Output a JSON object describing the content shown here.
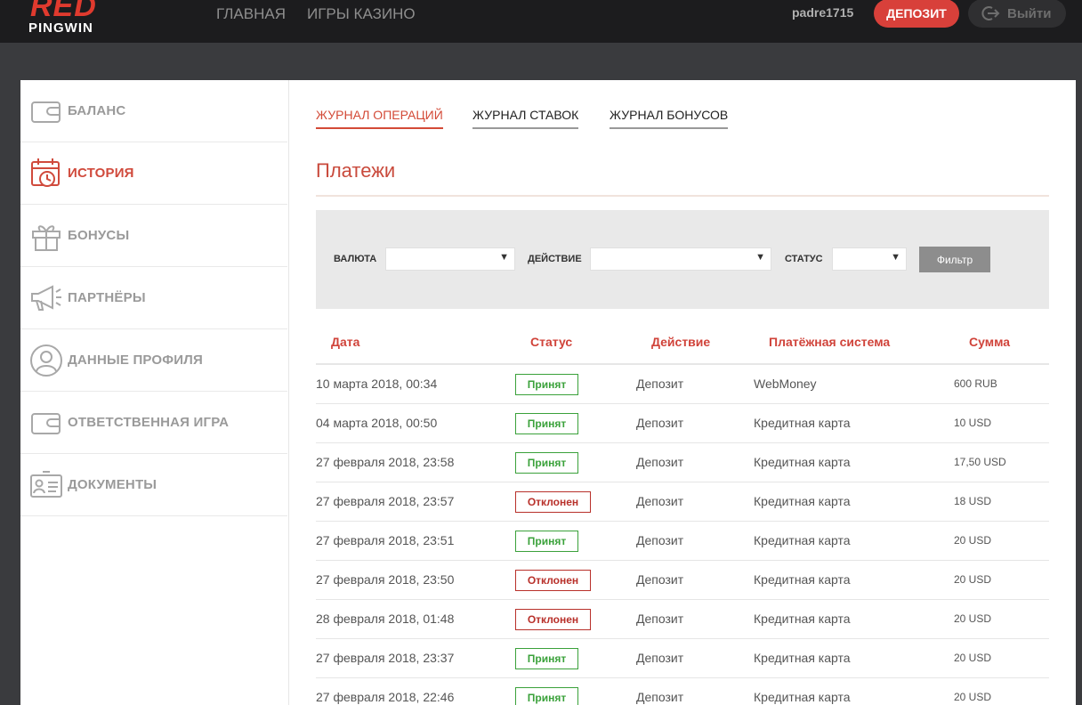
{
  "header": {
    "logo_top": "RED",
    "logo_bottom": "PINGWIN",
    "nav": [
      {
        "label": "ГЛАВНАЯ"
      },
      {
        "label": "ИГРЫ КАЗИНО"
      }
    ],
    "username": "padre1715",
    "deposit_label": "ДЕПОЗИТ",
    "logout_label": "Выйти"
  },
  "sidebar": {
    "items": [
      {
        "label": "БАЛАНС",
        "icon": "wallet-icon"
      },
      {
        "label": "ИСТОРИЯ",
        "icon": "calendar-clock-icon",
        "active": true
      },
      {
        "label": "БОНУСЫ",
        "icon": "gift-icon"
      },
      {
        "label": "ПАРТНЁРЫ",
        "icon": "megaphone-icon"
      },
      {
        "label": "ДАННЫЕ ПРОФИЛЯ",
        "icon": "user-profile-icon"
      },
      {
        "label": "ОТВЕТСТВЕННАЯ ИГРА",
        "icon": "wallet-icon"
      },
      {
        "label": "ДОКУМЕНТЫ",
        "icon": "id-card-icon"
      }
    ]
  },
  "tabs": [
    {
      "label": "ЖУРНАЛ ОПЕРАЦИЙ",
      "active": true
    },
    {
      "label": "ЖУРНАЛ СТАВОК"
    },
    {
      "label": "ЖУРНАЛ БОНУСОВ"
    }
  ],
  "section_title": "Платежи",
  "filter": {
    "currency_label": "ВАЛЮТА",
    "action_label": "ДЕЙСТВИЕ",
    "status_label": "СТАТУС",
    "currency_value": "",
    "action_value": "",
    "status_value": "",
    "button_label": "Фильтр"
  },
  "table": {
    "columns": [
      "Дата",
      "Статус",
      "Действие",
      "Платёжная система",
      "Сумма"
    ],
    "rows": [
      {
        "date": "10 марта 2018, 00:34",
        "status": "Принят",
        "status_type": "ok",
        "action": "Депозит",
        "system": "WebMoney",
        "amount": "600 RUB"
      },
      {
        "date": "04 марта 2018, 00:50",
        "status": "Принят",
        "status_type": "ok",
        "action": "Депозит",
        "system": "Кредитная карта",
        "amount": "10 USD"
      },
      {
        "date": "27 февраля 2018, 23:58",
        "status": "Принят",
        "status_type": "ok",
        "action": "Депозит",
        "system": "Кредитная карта",
        "amount": "17,50 USD"
      },
      {
        "date": "27 февраля 2018, 23:57",
        "status": "Отклонен",
        "status_type": "bad",
        "action": "Депозит",
        "system": "Кредитная карта",
        "amount": "18 USD"
      },
      {
        "date": "27 февраля 2018, 23:51",
        "status": "Принят",
        "status_type": "ok",
        "action": "Депозит",
        "system": "Кредитная карта",
        "amount": "20 USD"
      },
      {
        "date": "27 февраля 2018, 23:50",
        "status": "Отклонен",
        "status_type": "bad",
        "action": "Депозит",
        "system": "Кредитная карта",
        "amount": "20 USD"
      },
      {
        "date": "28 февраля 2018, 01:48",
        "status": "Отклонен",
        "status_type": "bad",
        "action": "Депозит",
        "system": "Кредитная карта",
        "amount": "20 USD"
      },
      {
        "date": "27 февраля 2018, 23:37",
        "status": "Принят",
        "status_type": "ok",
        "action": "Депозит",
        "system": "Кредитная карта",
        "amount": "20 USD"
      },
      {
        "date": "27 февраля 2018, 22:46",
        "status": "Принят",
        "status_type": "ok",
        "action": "Депозит",
        "system": "Кредитная карта",
        "amount": "20 USD"
      }
    ]
  },
  "colors": {
    "accent": "#d34a37",
    "accepted": "#3aa13a",
    "rejected": "#b8302a",
    "header_bg": "#1c1c1e",
    "page_bg": "#3a3b3e"
  }
}
